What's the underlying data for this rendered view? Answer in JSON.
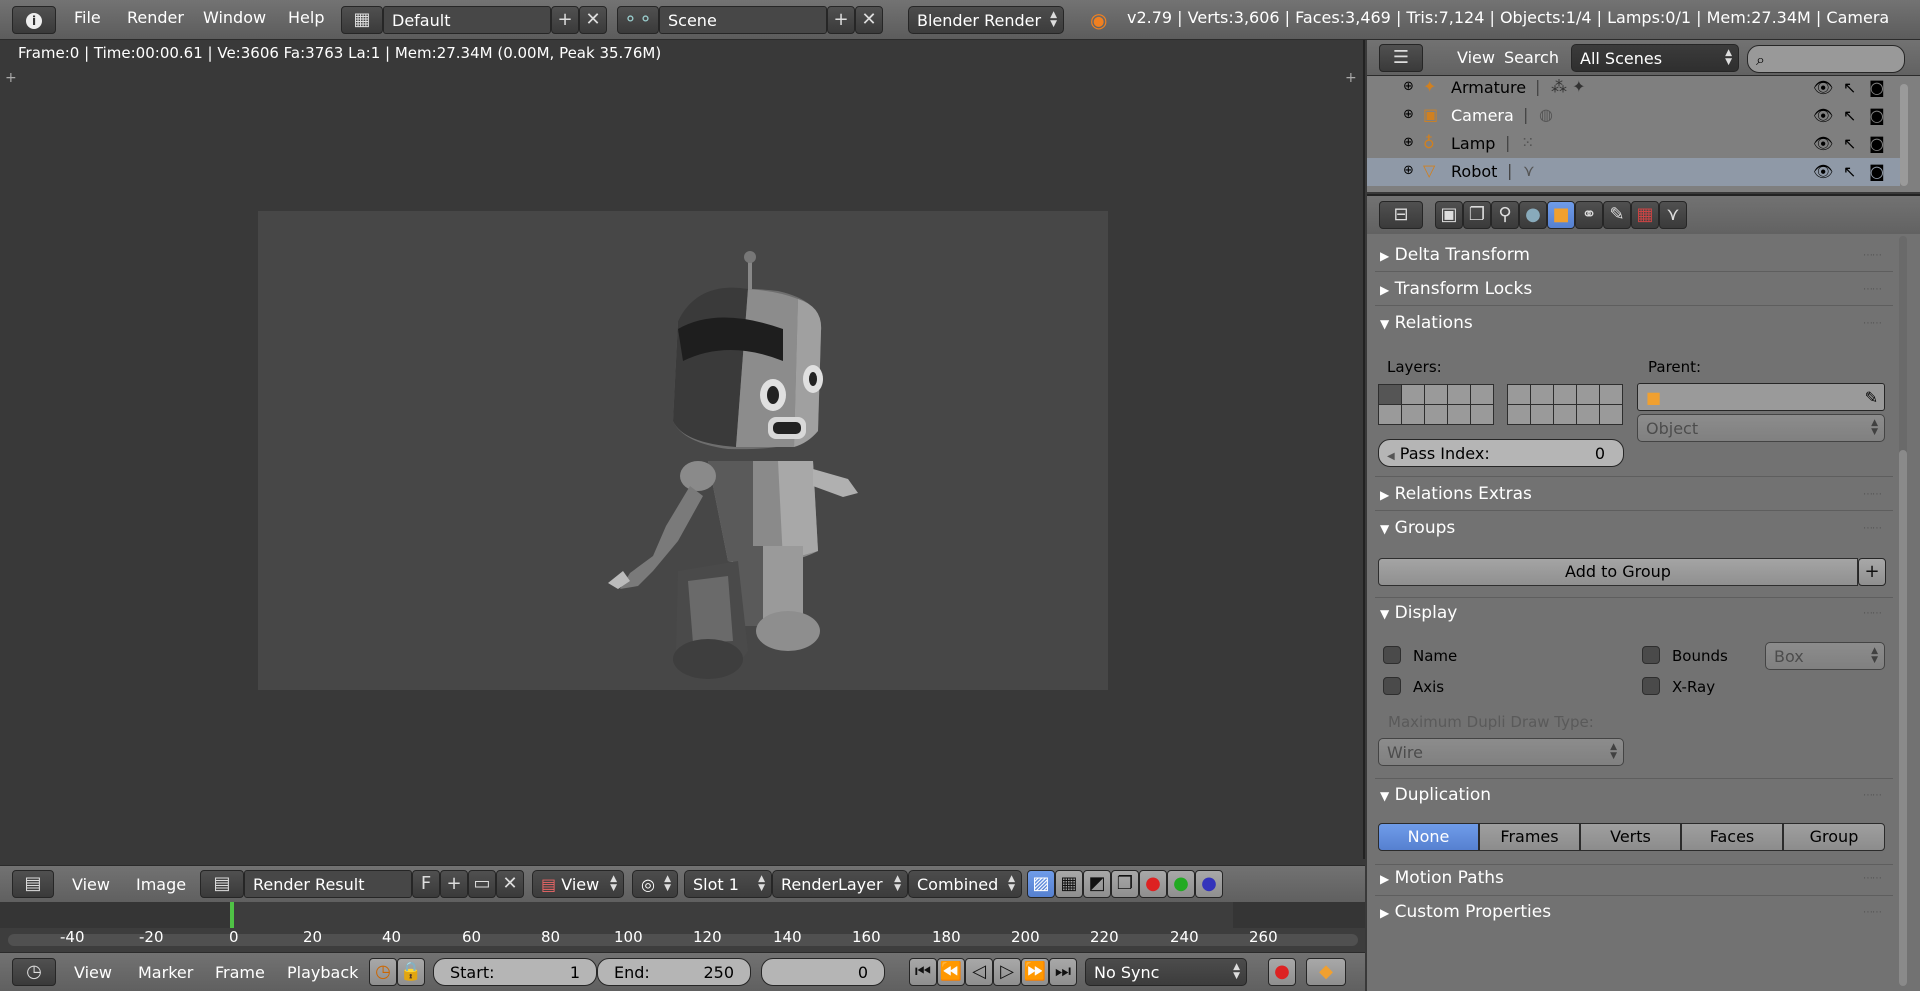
{
  "topbar": {
    "menus": [
      "File",
      "Render",
      "Window",
      "Help"
    ],
    "layout_name": "Default",
    "scene_name": "Scene",
    "engine": "Blender Render",
    "stats": "v2.79 | Verts:3,606 | Faces:3,469 | Tris:7,124 | Objects:1/4 | Lamps:0/1 | Mem:27.34M | Camera"
  },
  "viewport": {
    "info": "Frame:0 | Time:00:00.61 | Ve:3606 Fa:3763 La:1 | Mem:27.34M (0.00M, Peak 35.76M)"
  },
  "image_editor_header": {
    "view": "View",
    "image": "Image",
    "image_name": "Render Result",
    "fake_user": "F",
    "view_mode": "View",
    "slot": "Slot 1",
    "layer": "RenderLayer",
    "pass": "Combined"
  },
  "timeline": {
    "ticks": [
      "-40",
      "-20",
      "0",
      "20",
      "40",
      "60",
      "80",
      "100",
      "120",
      "140",
      "160",
      "180",
      "200",
      "220",
      "240",
      "260"
    ],
    "menus": [
      "View",
      "Marker",
      "Frame",
      "Playback"
    ],
    "start_label": "Start:",
    "start_value": "1",
    "end_label": "End:",
    "end_value": "250",
    "current_frame": "0",
    "sync": "No Sync"
  },
  "outliner": {
    "view": "View",
    "search": "Search",
    "filter": "All Scenes",
    "search_placeholder": "",
    "items": [
      {
        "label": "Armature"
      },
      {
        "label": "Camera"
      },
      {
        "label": "Lamp"
      },
      {
        "label": "Robot"
      }
    ]
  },
  "properties": {
    "panels": {
      "delta_transform": "Delta Transform",
      "transform_locks": "Transform Locks",
      "relations": "Relations",
      "relations_extras": "Relations Extras",
      "groups": "Groups",
      "display": "Display",
      "duplication": "Duplication",
      "motion_paths": "Motion Paths",
      "custom_properties": "Custom Properties"
    },
    "relations": {
      "layers_label": "Layers:",
      "parent_label": "Parent:",
      "parent_value": "",
      "parent_type": "Object",
      "pass_index_label": "Pass Index:",
      "pass_index_value": "0"
    },
    "groups": {
      "add_to_group": "Add to Group"
    },
    "display": {
      "name": "Name",
      "axis": "Axis",
      "bounds": "Bounds",
      "xray": "X-Ray",
      "bounds_type": "Box",
      "max_dupli_label": "Maximum Dupli Draw Type:",
      "max_dupli_value": "Wire"
    },
    "duplication": {
      "options": [
        "None",
        "Frames",
        "Verts",
        "Faces",
        "Group"
      ],
      "selected": "None"
    }
  },
  "colors": {
    "accent_blue": "#5680d0",
    "current_frame_green": "#4fc245",
    "object_orange": "#f0a030"
  }
}
